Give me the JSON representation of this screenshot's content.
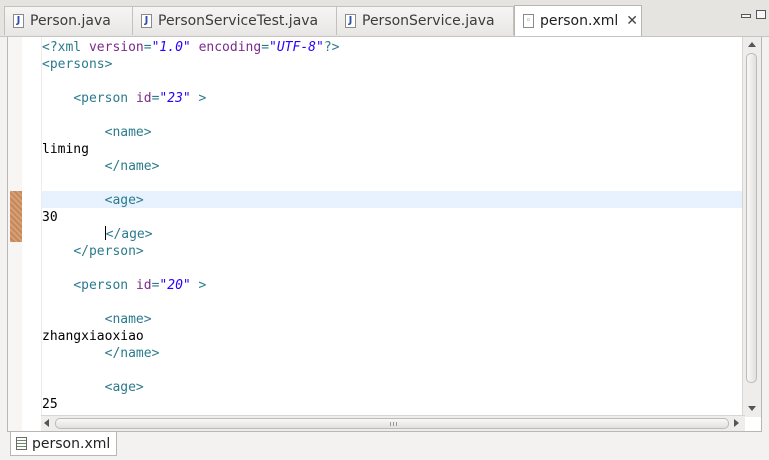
{
  "tabs": [
    {
      "label": "Person.java",
      "icon": "java-file-icon",
      "active": false
    },
    {
      "label": "PersonServiceTest.java",
      "icon": "java-file-icon",
      "active": false
    },
    {
      "label": "PersonService.java",
      "icon": "java-file-icon",
      "active": false
    },
    {
      "label": "person.xml",
      "icon": "xml-file-icon",
      "active": true
    }
  ],
  "tab_close_glyph": "✕",
  "source_lines": [
    {
      "indent": "",
      "segments": [
        [
          "tag",
          "<?xml "
        ],
        [
          "attr",
          "version"
        ],
        [
          "tag",
          "="
        ],
        [
          "val",
          "\"1.0\""
        ],
        [
          "tag",
          " "
        ],
        [
          "attr",
          "encoding"
        ],
        [
          "tag",
          "="
        ],
        [
          "val",
          "\"UTF-8\""
        ],
        [
          "tag",
          "?>"
        ]
      ]
    },
    {
      "indent": "",
      "segments": [
        [
          "tag",
          "<persons>"
        ]
      ]
    },
    {
      "indent": "",
      "segments": []
    },
    {
      "indent": "    ",
      "segments": [
        [
          "tag",
          "<person "
        ],
        [
          "attr",
          "id"
        ],
        [
          "tag",
          "="
        ],
        [
          "val",
          "\"23\""
        ],
        [
          "tag",
          " >"
        ]
      ]
    },
    {
      "indent": "",
      "segments": []
    },
    {
      "indent": "        ",
      "segments": [
        [
          "tag",
          "<name>"
        ]
      ]
    },
    {
      "indent": "",
      "segments": [
        [
          "text",
          "liming"
        ]
      ]
    },
    {
      "indent": "        ",
      "segments": [
        [
          "tag",
          "</name>"
        ]
      ]
    },
    {
      "indent": "",
      "segments": []
    },
    {
      "indent": "        ",
      "segments": [
        [
          "tag",
          "<age>"
        ]
      ]
    },
    {
      "indent": "",
      "segments": [
        [
          "text",
          "30"
        ]
      ]
    },
    {
      "indent": "        ",
      "segments": [
        [
          "tag",
          "</age>"
        ]
      ]
    },
    {
      "indent": "    ",
      "segments": [
        [
          "tag",
          "</person>"
        ]
      ]
    },
    {
      "indent": "",
      "segments": []
    },
    {
      "indent": "    ",
      "segments": [
        [
          "tag",
          "<person "
        ],
        [
          "attr",
          "id"
        ],
        [
          "tag",
          "="
        ],
        [
          "val",
          "\"20\""
        ],
        [
          "tag",
          " >"
        ]
      ]
    },
    {
      "indent": "",
      "segments": []
    },
    {
      "indent": "        ",
      "segments": [
        [
          "tag",
          "<name>"
        ]
      ]
    },
    {
      "indent": "",
      "segments": [
        [
          "text",
          "zhangxiaoxiao"
        ]
      ]
    },
    {
      "indent": "        ",
      "segments": [
        [
          "tag",
          "</name>"
        ]
      ]
    },
    {
      "indent": "",
      "segments": []
    },
    {
      "indent": "        ",
      "segments": [
        [
          "tag",
          "<age>"
        ]
      ]
    },
    {
      "indent": "",
      "segments": [
        [
          "text",
          "25"
        ]
      ]
    }
  ],
  "current_line": 9,
  "caret_line": 11,
  "bottom_tab": {
    "label": "person.xml",
    "icon": "source-page-icon"
  },
  "colors": {
    "tag": "#2a7b8c",
    "attr": "#7b2a8c",
    "value": "#2a00ff",
    "current_line_bg": "#e8f2fe"
  }
}
